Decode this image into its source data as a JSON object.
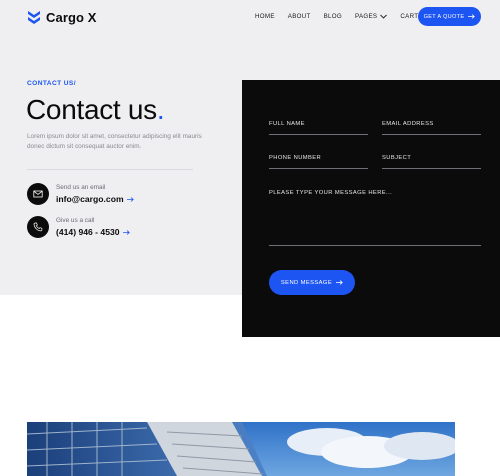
{
  "header": {
    "brand": "Cargo X",
    "nav": [
      "HOME",
      "ABOUT",
      "BLOG",
      "PAGES",
      "CART (0)"
    ],
    "quote_button": "GET A QUOTE"
  },
  "contact": {
    "eyebrow": "CONTACT US/",
    "title": "Contact us",
    "title_dot": ".",
    "intro": "Lorem ipsum dolor sit amet, consectetur adipiscing elit mauris donec dictum sit consequat auctor enim.",
    "email_label": "Send us an email",
    "email_value": "info@cargo.com",
    "phone_label": "Give us a call",
    "phone_value": "(414) 946 - 4530"
  },
  "form": {
    "full_name": "FULL NAME",
    "email": "EMAIL ADDRESS",
    "phone": "PHONE NUMBER",
    "subject": "SUBJECT",
    "message": "PLEASE TYPE YOUR MESSAGE HERE...",
    "submit": "SEND MESSAGE"
  },
  "colors": {
    "accent": "#1d55f2",
    "dark": "#0b0b0b",
    "hero_bg": "#efeff2"
  },
  "icons": {
    "logo": "chevron-stack-logo-icon",
    "email": "envelope-icon",
    "phone": "phone-icon",
    "arrow": "arrow-right-icon"
  }
}
